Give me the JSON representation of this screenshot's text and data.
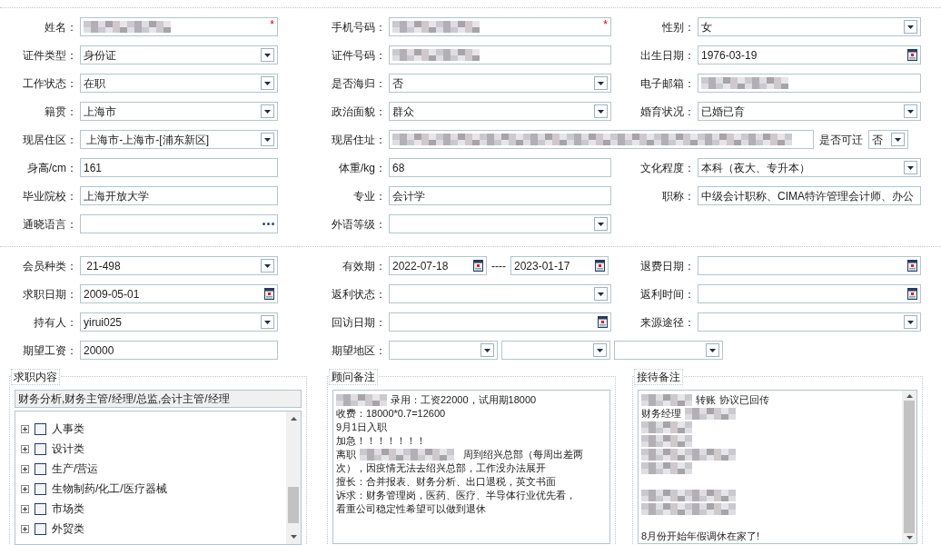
{
  "sections": [
    {
      "rows": [
        [
          {
            "label": "姓名：",
            "kind": "redacted",
            "required_mark": "*"
          },
          {
            "label": "手机号码：",
            "kind": "redacted",
            "required_mark": "*"
          },
          {
            "label": "性别：",
            "kind": "select",
            "value": "女"
          }
        ],
        [
          {
            "label": "证件类型：",
            "kind": "select",
            "value": "身份证"
          },
          {
            "label": "证件号码：",
            "kind": "redacted"
          },
          {
            "label": "出生日期：",
            "kind": "date",
            "value": "1976-03-19"
          }
        ],
        [
          {
            "label": "工作状态：",
            "kind": "select",
            "value": "在职"
          },
          {
            "label": "是否海归：",
            "kind": "select",
            "value": "否"
          },
          {
            "label": "电子邮箱：",
            "kind": "redacted"
          }
        ],
        [
          {
            "label": "籍贯：",
            "kind": "select",
            "value": "上海市"
          },
          {
            "label": "政治面貌：",
            "kind": "select",
            "value": "群众"
          },
          {
            "label": "婚育状况：",
            "kind": "select",
            "value": "已婚已育"
          }
        ],
        [
          {
            "label": "现居住区：",
            "kind": "select",
            "value": " 上海市-上海市-[浦东新区]"
          },
          {
            "label": "现居住址：",
            "kind": "address",
            "extra_label": "是否可迁",
            "extra_value": "否"
          }
        ],
        [
          {
            "label": "身高/cm：",
            "kind": "text",
            "value": "161"
          },
          {
            "label": "体重/kg：",
            "kind": "text",
            "value": "68"
          },
          {
            "label": "文化程度：",
            "kind": "select",
            "value": "本科（夜大、专升本）"
          }
        ],
        [
          {
            "label": "毕业院校：",
            "kind": "text",
            "value": "上海开放大学"
          },
          {
            "label": "专业：",
            "kind": "text",
            "value": "会计学"
          },
          {
            "label": "职称：",
            "kind": "text",
            "value": "中级会计职称、CIMA特许管理会计师、办公"
          }
        ],
        [
          {
            "label": "通晓语言：",
            "kind": "lookup"
          },
          {
            "label": "外语等级：",
            "kind": "select"
          },
          null
        ]
      ]
    },
    {
      "rows": [
        [
          {
            "label": "会员种类：",
            "kind": "select",
            "value": " 21-498"
          },
          {
            "label": "有效期：",
            "kind": "date_range",
            "value": "2022-07-18",
            "separator": "----",
            "value_end": "2023-01-17"
          },
          {
            "label": "退费日期：",
            "kind": "date"
          }
        ],
        [
          {
            "label": "求职日期：",
            "kind": "date",
            "value": "2009-05-01"
          },
          {
            "label": "返利状态：",
            "kind": "select"
          },
          {
            "label": "返利时间：",
            "kind": "date"
          }
        ],
        [
          {
            "label": "持有人：",
            "kind": "select",
            "value": "yirui025"
          },
          {
            "label": "回访日期：",
            "kind": "date"
          },
          {
            "label": "来源途径：",
            "kind": "select"
          }
        ],
        [
          {
            "label": "期望工资：",
            "kind": "text",
            "value": "20000"
          },
          {
            "label": "期望地区：",
            "kind": "triple_select"
          },
          null
        ]
      ]
    }
  ],
  "job_panel": {
    "legend": "求职内容",
    "summary": "财务分析,财务主管/经理/总监,会计主管/经理",
    "items": [
      {
        "label": "人事类",
        "checked": false,
        "expanded": false
      },
      {
        "label": "设计类",
        "checked": false,
        "expanded": false
      },
      {
        "label": "生产/营运",
        "checked": false,
        "expanded": false
      },
      {
        "label": "生物制药/化工/医疗器械",
        "checked": false,
        "expanded": false
      },
      {
        "label": "市场类",
        "checked": false,
        "expanded": false
      },
      {
        "label": "外贸类",
        "checked": false,
        "expanded": false
      }
    ]
  },
  "notes": [
    {
      "legend": "顾问备注",
      "scrollbar": false,
      "lines": [
        [
          {
            "kind": "redacted"
          },
          {
            "kind": "text",
            "text": "录用：工资22000，试用期18000"
          }
        ],
        [
          {
            "kind": "text",
            "text": "收费：18000*0.7=12600"
          }
        ],
        [
          {
            "kind": "text",
            "text": "9月1日入职"
          }
        ],
        [
          {
            "kind": "text",
            "text": "加急！！！！！！！"
          }
        ],
        [
          {
            "kind": "text",
            "text": "离职 "
          },
          {
            "kind": "redacted_long"
          },
          {
            "kind": "text",
            "text": "周到绍兴总部（每周出差两"
          }
        ],
        [
          {
            "kind": "text",
            "text": "次），因疫情无法去绍兴总部，工作没办法展开"
          }
        ],
        [
          {
            "kind": "text",
            "text": "擅长：合并报表、财务分析、出口退税，英文书面"
          }
        ],
        [
          {
            "kind": "text",
            "text": "诉求：财务管理岗，医药、医疗、半导体行业优先看，"
          }
        ],
        [
          {
            "kind": "text",
            "text": "看重公司稳定性希望可以做到退休"
          }
        ]
      ]
    },
    {
      "legend": "接待备注",
      "scrollbar": true,
      "lines": [
        [
          {
            "kind": "redacted"
          },
          {
            "kind": "text",
            "text": "转账"
          },
          {
            "kind": "text",
            "text": "协议已回传"
          }
        ],
        [
          {
            "kind": "text",
            "text": "财务经理"
          },
          {
            "kind": "redacted"
          }
        ],
        [
          {
            "kind": "redacted"
          }
        ],
        [
          {
            "kind": "redacted"
          }
        ],
        [
          {
            "kind": "redacted_long"
          }
        ],
        [
          {
            "kind": "redacted"
          }
        ],
        [
          {
            "kind": "blank"
          }
        ],
        [
          {
            "kind": "redacted_long"
          }
        ],
        [
          {
            "kind": "redacted_long"
          }
        ],
        [
          {
            "kind": "blank"
          }
        ],
        [
          {
            "kind": "text",
            "text": "8月份开始年假调休在家了!"
          }
        ]
      ]
    }
  ]
}
